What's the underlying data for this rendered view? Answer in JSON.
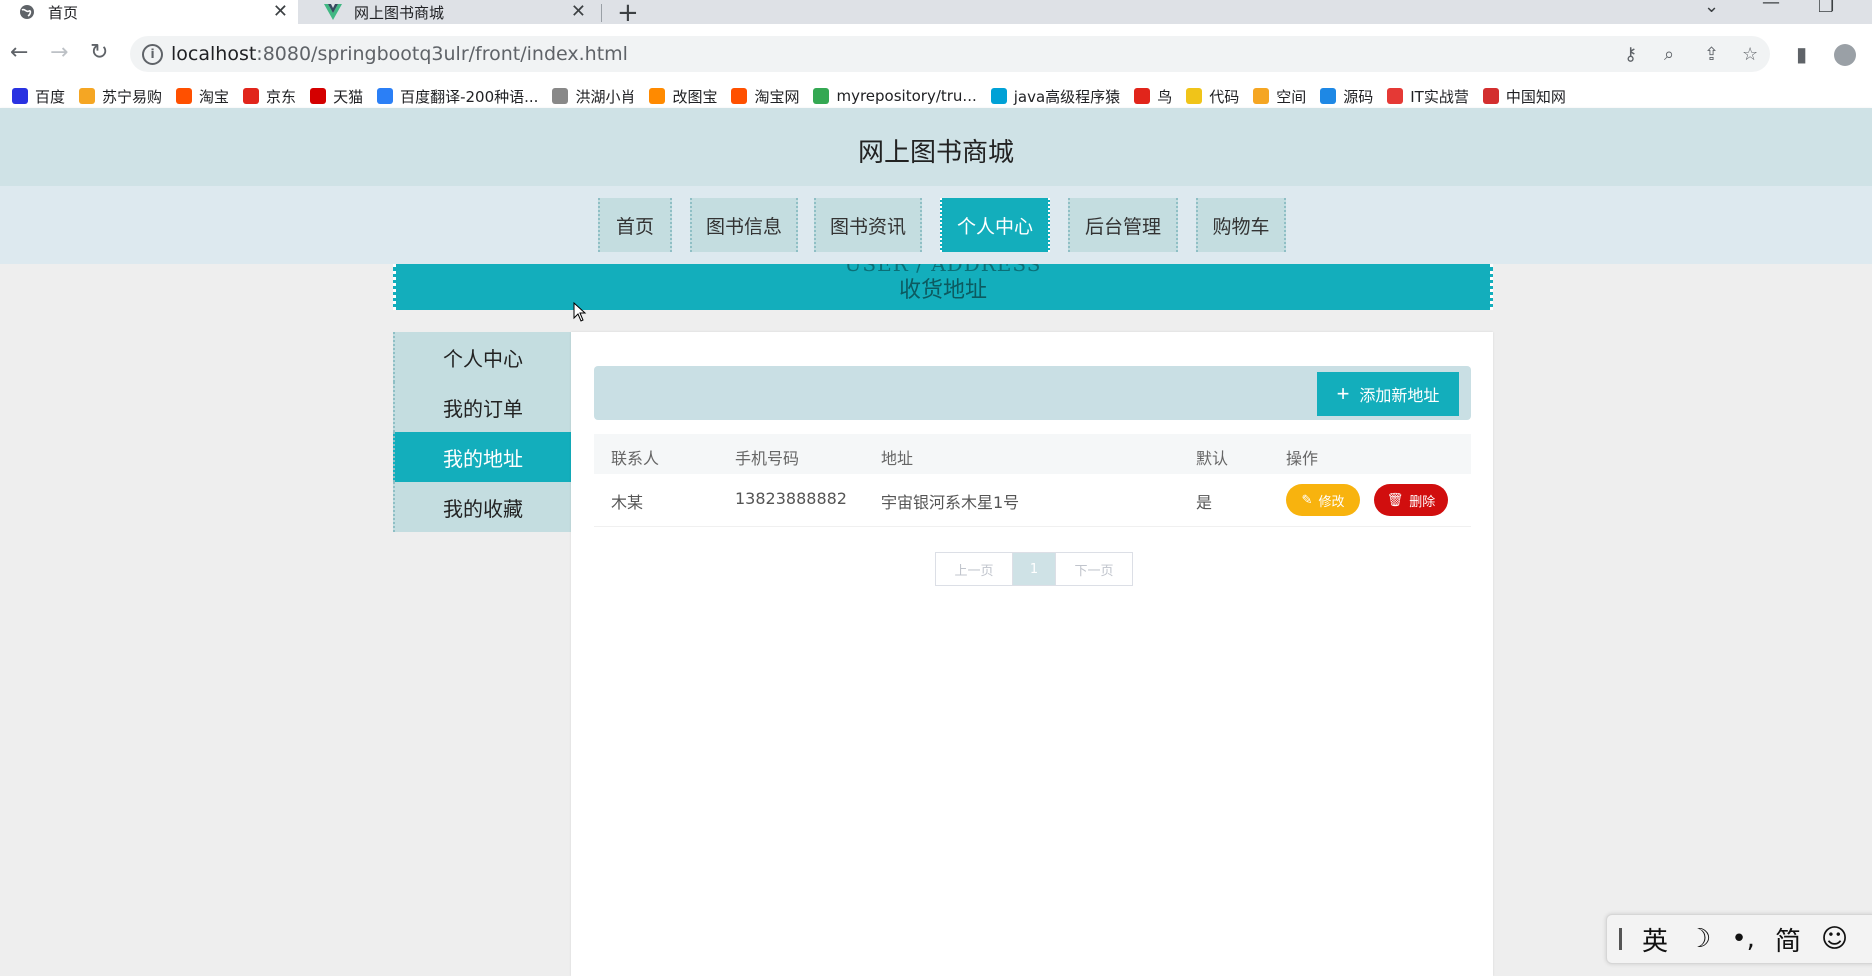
{
  "browser": {
    "tabs": [
      {
        "title": "首页",
        "icon": "globe-icon",
        "active": true
      },
      {
        "title": "网上图书商城",
        "icon": "vue-logo-icon",
        "active": false
      }
    ],
    "url_host": "localhost",
    "url_rest": ":8080/springbootq3ulr/front/index.html",
    "bookmarks": [
      {
        "label": "百度",
        "color": "#2932e1"
      },
      {
        "label": "苏宁易购",
        "color": "#f5a623"
      },
      {
        "label": "淘宝",
        "color": "#ff5000"
      },
      {
        "label": "京东",
        "color": "#e1251b"
      },
      {
        "label": "天猫",
        "color": "#d40000"
      },
      {
        "label": "百度翻译-200种语...",
        "color": "#2b7ff6"
      },
      {
        "label": "洪湖小肖",
        "color": "#888888"
      },
      {
        "label": "改图宝",
        "color": "#ff8a00"
      },
      {
        "label": "淘宝网",
        "color": "#ff5000"
      },
      {
        "label": "myrepository/tru...",
        "color": "#34a853"
      },
      {
        "label": "java高级程序猿",
        "color": "#00a1d6"
      },
      {
        "label": "鸟",
        "color": "#e1251b"
      },
      {
        "label": "代码",
        "color": "#f0c419"
      },
      {
        "label": "空间",
        "color": "#f5a623"
      },
      {
        "label": "源码",
        "color": "#1e88e5"
      },
      {
        "label": "IT实战营",
        "color": "#e53935"
      },
      {
        "label": "中国知网",
        "color": "#d32f2f"
      }
    ]
  },
  "site": {
    "title": "网上图书商城",
    "nav": [
      "首页",
      "图书信息",
      "图书资讯",
      "个人中心",
      "后台管理",
      "购物车"
    ],
    "active_nav": "个人中心",
    "banner_en": "USER / ADDRESS",
    "banner_cn": "收货地址"
  },
  "side_menu": {
    "items": [
      "个人中心",
      "我的订单",
      "我的地址",
      "我的收藏"
    ],
    "active": "我的地址"
  },
  "address": {
    "add_button": "添加新地址",
    "columns": [
      "联系人",
      "手机号码",
      "地址",
      "默认",
      "操作"
    ],
    "rows": [
      {
        "name": "木某",
        "phone": "13823888882",
        "address": "宇宙银河系木星1号",
        "default": "是"
      }
    ],
    "edit_label": "修改",
    "delete_label": "删除"
  },
  "pagination": {
    "prev": "上一页",
    "current": "1",
    "next": "下一页"
  },
  "ime": {
    "lang": "英",
    "moon": "☽",
    "punct": "•,",
    "script": "简",
    "emoji": "☺"
  }
}
